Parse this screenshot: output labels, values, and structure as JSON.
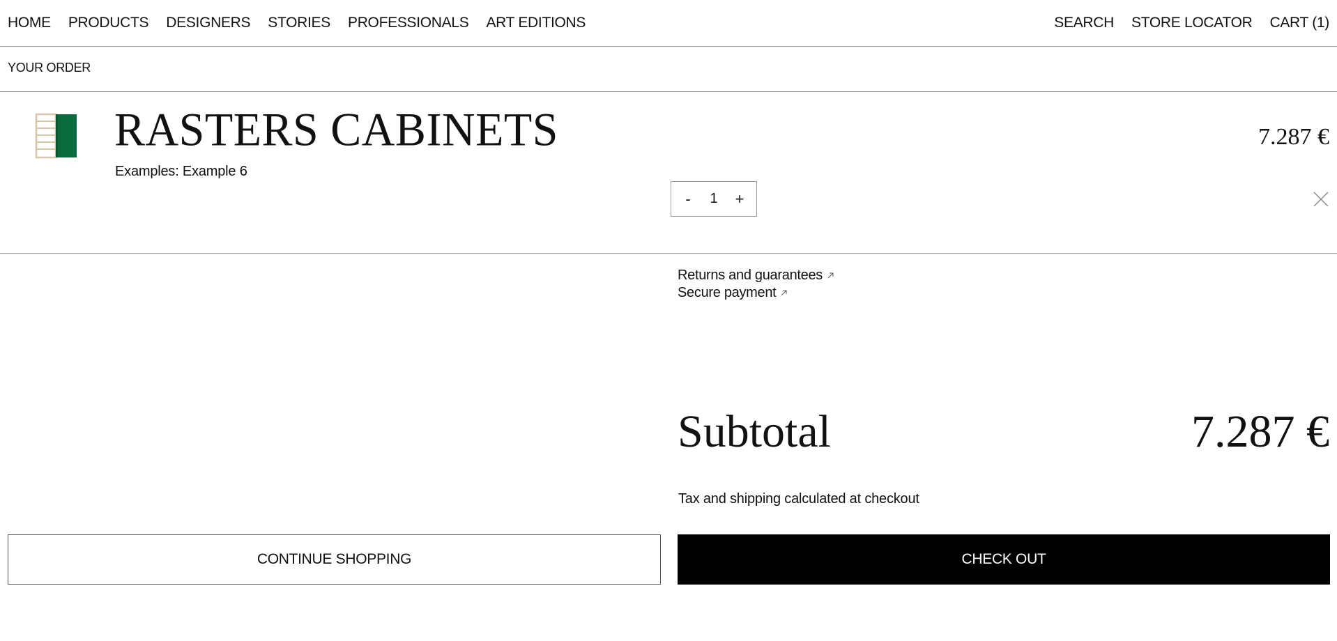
{
  "nav": {
    "left": [
      "HOME",
      "PRODUCTS",
      "DESIGNERS",
      "STORIES",
      "PROFESSIONALS",
      "ART EDITIONS"
    ],
    "search": "SEARCH",
    "store_locator": "STORE LOCATOR",
    "cart": "CART (1)"
  },
  "order": {
    "heading": "YOUR ORDER"
  },
  "item": {
    "title": "RASTERS CABINETS",
    "variant": "Examples: Example 6",
    "price": "7.287 €",
    "quantity": "1",
    "decrement": "-",
    "increment": "+"
  },
  "links": {
    "returns": "Returns and guarantees",
    "secure": "Secure payment"
  },
  "summary": {
    "subtotal_label": "Subtotal",
    "subtotal_value": "7.287 €",
    "tax_note": "Tax and shipping calculated at checkout"
  },
  "actions": {
    "continue": "CONTINUE SHOPPING",
    "checkout": "CHECK OUT"
  },
  "colors": {
    "cabinet_green": "#0b6b3e",
    "cabinet_frame": "#d8c6a8",
    "checkout_bg": "#000000"
  },
  "icons": [
    "external-arrow-icon",
    "close-icon"
  ]
}
